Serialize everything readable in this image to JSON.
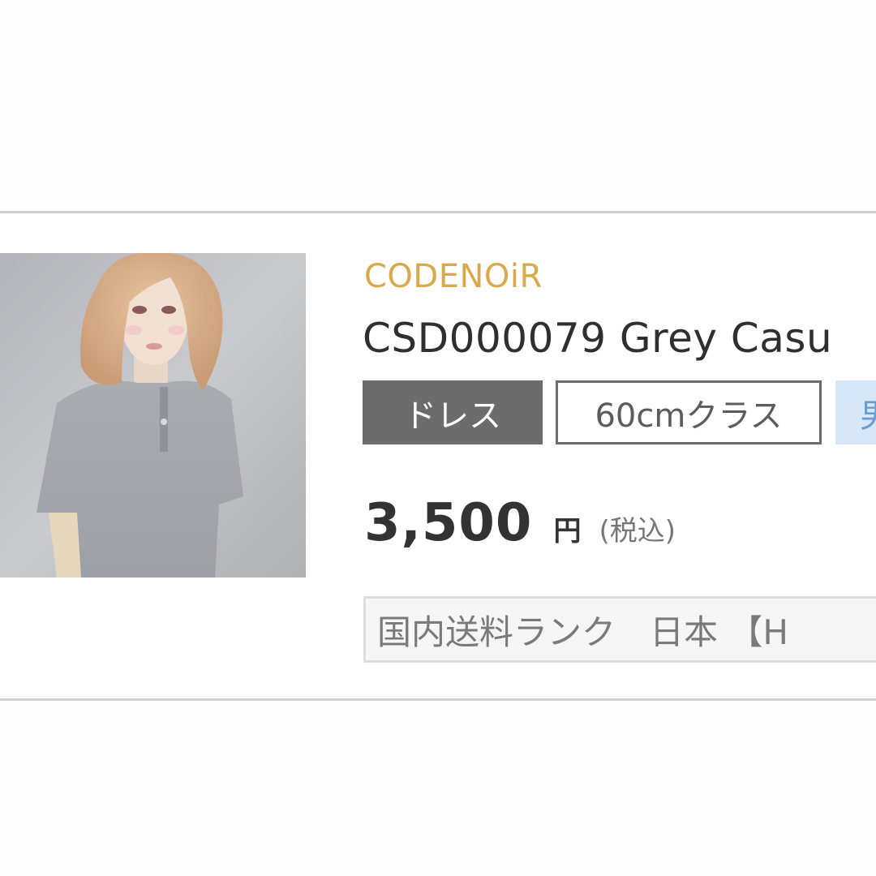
{
  "product": {
    "brand": "CODENOiR",
    "title": "CSD000079 Grey Casu",
    "image_alt": "Doll wearing grey casual short-sleeve henley t-shirt",
    "tags": [
      {
        "label": "ドレス",
        "color": "#6c6c6c"
      },
      {
        "label": "60cmクラス",
        "color": "#6c6c6c"
      },
      {
        "label": "男",
        "color": "#6a9bd2"
      }
    ],
    "price": "3,500",
    "currency": "円",
    "tax_note": "(税込)",
    "shipping_text": "国内送料ランク　日本 【H"
  },
  "colors": {
    "brand": "#d9a94a",
    "tag_dark": "#6c6c6c",
    "tag_blue_bg": "#d8e7f7",
    "border": "#cfcfcf"
  }
}
